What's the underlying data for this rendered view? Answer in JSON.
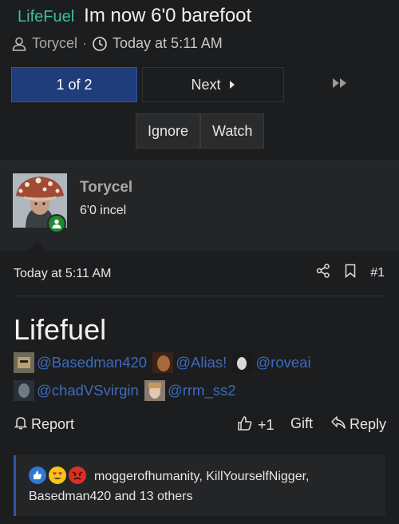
{
  "header": {
    "prefix": "LifeFuel",
    "title": "Im now 6'0 barefoot",
    "author": "Torycel",
    "separator": "·",
    "time": "Today at 5:11 AM"
  },
  "pagination": {
    "current": "1 of 2",
    "next": "Next"
  },
  "thread_buttons": {
    "ignore": "Ignore",
    "watch": "Watch"
  },
  "user": {
    "name": "Torycel",
    "title": "6'0 incel",
    "online": true
  },
  "post": {
    "time": "Today at 5:11 AM",
    "number": "#1",
    "heading": "Lifefuel",
    "mentions": [
      {
        "name": "@Basedman420"
      },
      {
        "name": "@Alias!"
      },
      {
        "name": "@roveai"
      },
      {
        "name": "@chadVSvirgin"
      },
      {
        "name": "@rrm_ss2"
      }
    ]
  },
  "actions": {
    "report": "Report",
    "likes": "+1",
    "gift": "Gift",
    "reply": "Reply"
  },
  "reactions": {
    "text": "moggerofhumanity, KillYourselfNigger, Basedman420 and 13 others"
  },
  "colors": {
    "prefix": "#3dbf9a",
    "accent": "#1f3d7a",
    "link": "#3c6bc0",
    "online": "#1d8a2f"
  }
}
